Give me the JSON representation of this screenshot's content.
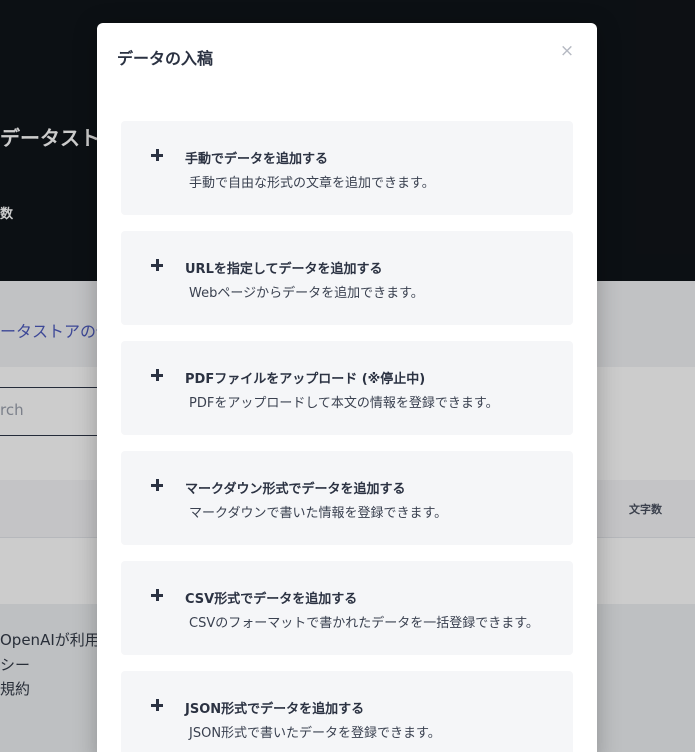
{
  "background": {
    "header_title": "データスト",
    "header_stat": "数",
    "tab_label": "ータストアの使",
    "search_placeholder": "rch",
    "table_column": "文字数",
    "footer_lines": [
      "OpenAIが利用",
      "シー",
      "規約"
    ]
  },
  "modal": {
    "title": "データの入稿",
    "close_label": "×",
    "options": [
      {
        "title": "手動でデータを追加する",
        "description": "手動で自由な形式の文章を追加できます。"
      },
      {
        "title": "URLを指定してデータを追加する",
        "description": "Webページからデータを追加できます。"
      },
      {
        "title": "PDFファイルをアップロード (※停止中)",
        "description": "PDFをアップロードして本文の情報を登録できます。"
      },
      {
        "title": "マークダウン形式でデータを追加する",
        "description": "マークダウンで書いた情報を登録できます。"
      },
      {
        "title": "CSV形式でデータを追加する",
        "description": "CSVのフォーマットで書かれたデータを一括登録できます。"
      },
      {
        "title": "JSON形式でデータを追加する",
        "description": "JSON形式で書いたデータを登録できます。"
      }
    ]
  },
  "icons": {
    "option_icon": "plus-icon",
    "close_icon": "close-icon"
  }
}
